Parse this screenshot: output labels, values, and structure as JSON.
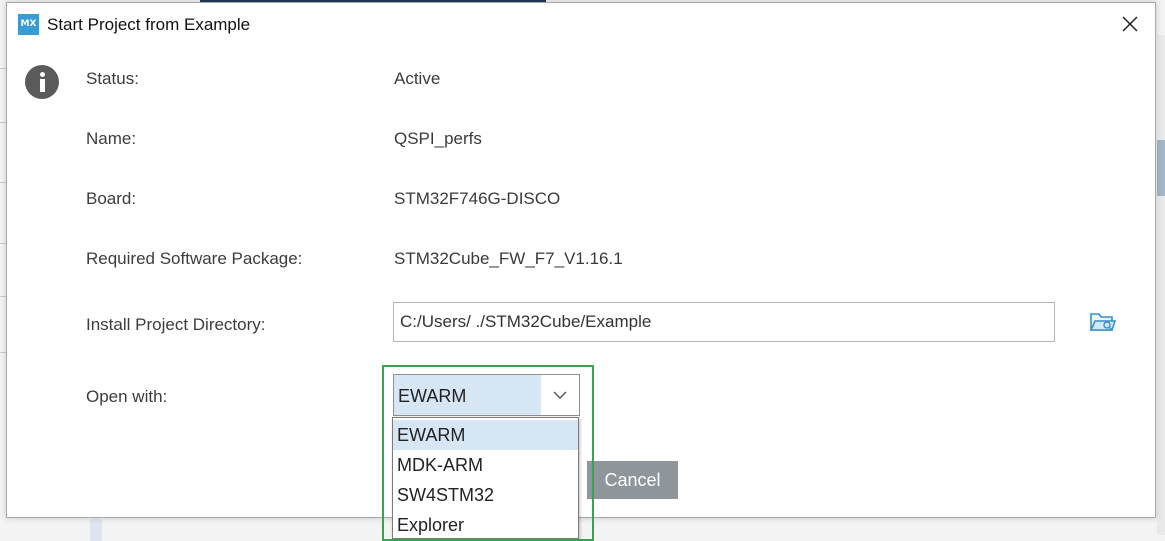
{
  "dialog": {
    "title": "Start Project from Example",
    "logo_text": "MX",
    "close_symbol": "close-icon"
  },
  "fields": {
    "status_label": "Status:",
    "status_value": "Active",
    "name_label": "Name:",
    "name_value": "QSPI_perfs",
    "board_label": "Board:",
    "board_value": "STM32F746G-DISCO",
    "package_label": "Required Software Package:",
    "package_value": "STM32Cube_FW_F7_V1.16.1",
    "directory_label": "Install Project Directory:",
    "directory_value": "C:/Users/           ./STM32Cube/Example",
    "open_with_label": "Open with:"
  },
  "open_with": {
    "selected": "EWARM",
    "options": [
      "EWARM",
      "MDK-ARM",
      "SW4STM32",
      "Explorer"
    ]
  },
  "buttons": {
    "cancel": "Cancel"
  },
  "icons": {
    "info": "info-icon",
    "browse": "folder-open-icon",
    "dropdown": "chevron-down-icon"
  },
  "colors": {
    "logo": "#3a9bd5",
    "select_highlight": "#d7e6f5",
    "annotation_box": "#3aa24a",
    "cancel_bg": "#8e959b"
  }
}
